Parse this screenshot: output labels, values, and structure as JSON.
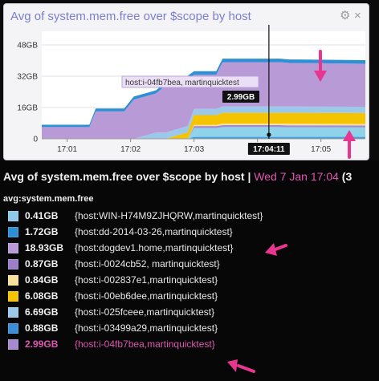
{
  "widget": {
    "title": "Avg of system.mem.free over $scope by host"
  },
  "tooltip": {
    "host_label": "host:i-04fb7bea, martinquicktest",
    "value_label": "2.99GB",
    "time_label": "17:04:11"
  },
  "panel": {
    "title": "Avg of system.mem.free over $scope by host",
    "separator": "|",
    "timestamp": "Wed 7 Jan 17:04",
    "cut": "(3",
    "metric": "avg:system.mem.free"
  },
  "legend": [
    {
      "value": "0.41GB",
      "tag": "{host:WIN-H74M9ZJHQRW,martinquicktest}",
      "color": "#8ec9e8"
    },
    {
      "value": "1.72GB",
      "tag": "{host:dd-2014-03-26,martinquicktest}",
      "color": "#2f8fd4"
    },
    {
      "value": "18.93GB",
      "tag": "{host:dogdev1.home,martinquicktest}",
      "color": "#b79ad6"
    },
    {
      "value": "0.87GB",
      "tag": "{host:i-0024cb52, martinquicktest}",
      "color": "#9b7fc8"
    },
    {
      "value": "0.84GB",
      "tag": "{host:i-002837e1,martinquicktest}",
      "color": "#f7e09a"
    },
    {
      "value": "6.08GB",
      "tag": "{host:i-00eb6dee,martinquicktest}",
      "color": "#f5c400"
    },
    {
      "value": "6.69GB",
      "tag": "{host:i-025fceee,martinquicktest}",
      "color": "#9cc8ea"
    },
    {
      "value": "0.88GB",
      "tag": "{host:i-03499a29,martinquicktest}",
      "color": "#3c8ed6"
    },
    {
      "value": "2.99GB",
      "tag": "{host:i-04fb7bea,martinquicktest}",
      "color": "#a68ad0",
      "highlight": true
    }
  ],
  "chart_data": {
    "type": "area",
    "stacked": true,
    "title": "Avg of system.mem.free over $scope by host",
    "x_ticks": [
      "17:01",
      "17:02",
      "17:03",
      "17:04",
      "17:05"
    ],
    "x_tick_minutes": [
      1,
      2,
      3,
      4,
      5
    ],
    "y_ticks": [
      "0",
      "16GB",
      "32GB",
      "48GB"
    ],
    "y_tick_values": [
      0,
      16,
      32,
      48
    ],
    "ylim": [
      0,
      55
    ],
    "xlim_minutes": [
      0.6,
      5.7
    ],
    "grid": true,
    "cursor_minute": 4.18,
    "x": [
      0.6,
      1.35,
      1.45,
      1.9,
      2.05,
      2.4,
      2.55,
      2.9,
      3.0,
      3.35,
      3.45,
      4.35,
      4.5,
      5.7
    ],
    "series": [
      {
        "color": "#3aa0d8",
        "values": [
          0,
          0,
          0,
          0,
          0,
          0,
          0,
          0,
          0.5,
          0.5,
          0.5,
          0.5,
          0.5,
          0.5
        ]
      },
      {
        "color": "#2f8fd4",
        "values": [
          0,
          0,
          0,
          0,
          0,
          0,
          0,
          0,
          0.5,
          0.5,
          0.5,
          0.5,
          0.5,
          0.5
        ]
      },
      {
        "color": "#8fd3ea",
        "values": [
          0,
          0,
          0,
          0,
          0,
          0,
          0,
          0,
          4.5,
          4.5,
          5.0,
          5.0,
          4.9,
          4.8
        ]
      },
      {
        "color": "#a68ad0",
        "values": [
          0,
          0,
          0,
          0,
          0,
          0,
          0,
          0,
          1.0,
          1.0,
          1.0,
          1.0,
          1.0,
          1.0
        ]
      },
      {
        "color": "#f7e09a",
        "values": [
          0,
          0,
          0,
          0,
          0,
          0,
          0,
          0,
          0.6,
          0.6,
          0.8,
          0.8,
          0.8,
          0.8
        ]
      },
      {
        "color": "#f5c400",
        "values": [
          0,
          0,
          0,
          0,
          0,
          0,
          0,
          3.3,
          5.0,
          5.0,
          5.5,
          5.5,
          5.6,
          5.6
        ]
      },
      {
        "color": "#9cc8ea",
        "values": [
          0,
          0,
          0,
          0,
          0,
          3.2,
          3.2,
          3.2,
          3.2,
          3.2,
          3.2,
          3.2,
          3.2,
          3.2
        ]
      },
      {
        "color": "#b79ad6",
        "values": [
          6,
          6,
          14,
          14,
          20,
          20,
          24,
          24,
          17.5,
          17.5,
          22.7,
          22.7,
          22.3,
          22.0
        ]
      },
      {
        "color": "#2f8fd4",
        "values": [
          1.2,
          1.2,
          1.5,
          1.5,
          1.6,
          1.6,
          1.7,
          1.7,
          1.8,
          1.8,
          1.8,
          1.8,
          1.8,
          1.8
        ]
      }
    ]
  }
}
